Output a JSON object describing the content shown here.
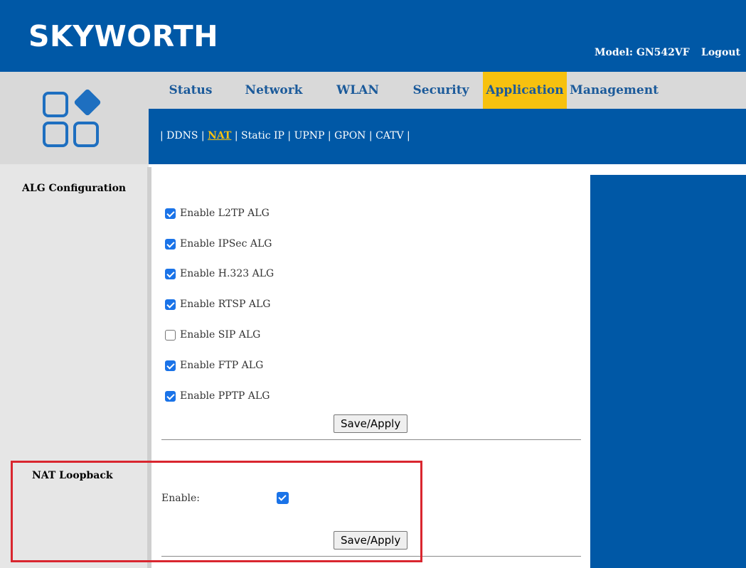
{
  "header": {
    "brand": "SKYWORTH",
    "model": "Model: GN542VF",
    "logout": "Logout",
    "bg_color": "#0058a6"
  },
  "logo": {
    "icon": "app-grid-icon",
    "color": "#1e6fc0"
  },
  "nav": {
    "items": [
      {
        "label": "Status"
      },
      {
        "label": "Network"
      },
      {
        "label": "WLAN"
      },
      {
        "label": "Security"
      },
      {
        "label": "Application",
        "active": true
      },
      {
        "label": "Management"
      }
    ],
    "active_color": "#f7c10f"
  },
  "subnav": {
    "items": [
      {
        "label": "DDNS"
      },
      {
        "label": "NAT",
        "active": true
      },
      {
        "label": "Static IP"
      },
      {
        "label": "UPNP"
      },
      {
        "label": "GPON"
      },
      {
        "label": "CATV"
      }
    ]
  },
  "alg": {
    "title": "ALG Configuration",
    "options": [
      {
        "label": "Enable L2TP ALG",
        "checked": true
      },
      {
        "label": "Enable IPSec ALG",
        "checked": true
      },
      {
        "label": "Enable H.323 ALG",
        "checked": true
      },
      {
        "label": "Enable RTSP ALG",
        "checked": true
      },
      {
        "label": "Enable SIP ALG",
        "checked": false
      },
      {
        "label": "Enable FTP ALG",
        "checked": true
      },
      {
        "label": "Enable PPTP ALG",
        "checked": true
      }
    ],
    "save_label": "Save/Apply"
  },
  "loopback": {
    "title": "NAT Loopback",
    "enable_label": "Enable:",
    "enabled": true,
    "save_label": "Save/Apply"
  },
  "highlight_color": "#d9262f"
}
